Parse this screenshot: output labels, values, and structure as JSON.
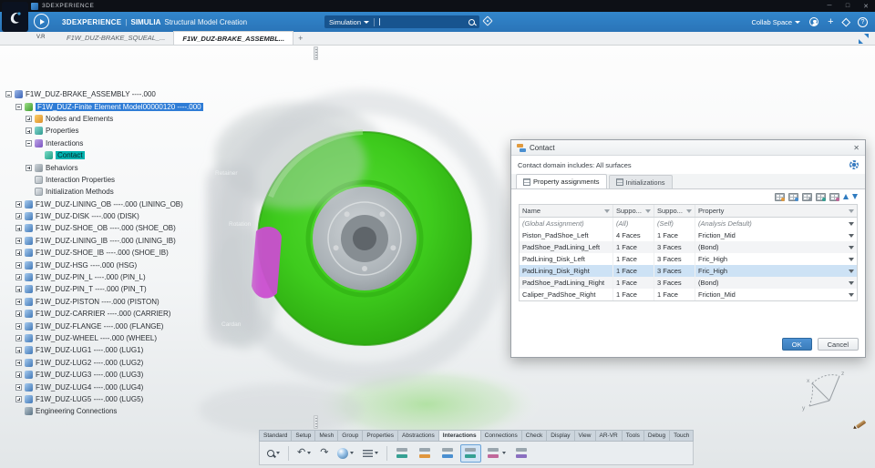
{
  "window": {
    "title": "3DEXPERIENCE",
    "minimize": "─",
    "maximize": "□",
    "close": "✕"
  },
  "appbar": {
    "brand": "3DEXPERIENCE",
    "divider": "|",
    "app_name": "SIMULIA",
    "app_desc": "Structural Model Creation",
    "search_scope": "Simulation",
    "collab_label": "Collab Space",
    "add_label": "+",
    "help_label": "?",
    "icons": [
      "compass-logo-icon",
      "play-compass-icon",
      "search-icon",
      "tag-icon",
      "user-icon",
      "add-icon",
      "share-icon",
      "help-icon"
    ]
  },
  "compass_version": "V.R",
  "doc_tabs": {
    "items": [
      {
        "label": "F1W_DUZ-BRAKE_SQUEAL_...",
        "cls": ""
      },
      {
        "label": "F1W_DUZ-BRAKE_ASSEMBL...",
        "cls": "active"
      }
    ],
    "add_label": "+"
  },
  "tree": {
    "items": [
      {
        "label": "F1W_DUZ-BRAKE_ASSEMBLY ----.000",
        "cls": "lv0",
        "exp": "minus",
        "icon": "i-assembly"
      },
      {
        "label": "F1W_DUZ-Finite Element Model00000120 ----.000",
        "cls": "lv1 sel-blue",
        "exp": "minus",
        "icon": "i-fem"
      },
      {
        "label": "Nodes and Elements",
        "cls": "lv2",
        "exp": "plus",
        "icon": "i-nodes"
      },
      {
        "label": "Properties",
        "cls": "lv2",
        "exp": "plus",
        "icon": "i-props"
      },
      {
        "label": "Interactions",
        "cls": "lv2",
        "exp": "minus",
        "icon": "i-inter"
      },
      {
        "label": "Contact",
        "cls": "lv3 sel-teal",
        "exp": "none",
        "icon": "i-contact"
      },
      {
        "label": "Behaviors",
        "cls": "lv2",
        "exp": "plus",
        "icon": "i-behav"
      },
      {
        "label": "Interaction Properties",
        "cls": "lv2",
        "exp": "none",
        "icon": "i-fold"
      },
      {
        "label": "Initialization Methods",
        "cls": "lv2",
        "exp": "none",
        "icon": "i-fold"
      },
      {
        "label": "F1W_DUZ-LINING_OB ----.000 (LINING_OB)",
        "cls": "lv1",
        "exp": "plus",
        "icon": "i-part"
      },
      {
        "label": "F1W_DUZ-DISK ----.000 (DISK)",
        "cls": "lv1",
        "exp": "plus",
        "icon": "i-part"
      },
      {
        "label": "F1W_DUZ-SHOE_OB ----.000 (SHOE_OB)",
        "cls": "lv1",
        "exp": "plus",
        "icon": "i-part"
      },
      {
        "label": "F1W_DUZ-LINING_IB ----.000 (LINING_IB)",
        "cls": "lv1",
        "exp": "plus",
        "icon": "i-part"
      },
      {
        "label": "F1W_DUZ-SHOE_IB ----.000 (SHOE_IB)",
        "cls": "lv1",
        "exp": "plus",
        "icon": "i-part"
      },
      {
        "label": "F1W_DUZ-HSG ----.000 (HSG)",
        "cls": "lv1",
        "exp": "plus",
        "icon": "i-part"
      },
      {
        "label": "F1W_DUZ-PIN_L ----.000 (PIN_L)",
        "cls": "lv1",
        "exp": "plus",
        "icon": "i-part"
      },
      {
        "label": "F1W_DUZ-PIN_T ----.000 (PIN_T)",
        "cls": "lv1",
        "exp": "plus",
        "icon": "i-part"
      },
      {
        "label": "F1W_DUZ-PISTON ----.000 (PISTON)",
        "cls": "lv1",
        "exp": "plus",
        "icon": "i-part"
      },
      {
        "label": "F1W_DUZ-CARRIER ----.000 (CARRIER)",
        "cls": "lv1",
        "exp": "plus",
        "icon": "i-part"
      },
      {
        "label": "F1W_DUZ-FLANGE ----.000 (FLANGE)",
        "cls": "lv1",
        "exp": "plus",
        "icon": "i-part"
      },
      {
        "label": "F1W_DUZ-WHEEL ----.000 (WHEEL)",
        "cls": "lv1",
        "exp": "plus",
        "icon": "i-part"
      },
      {
        "label": "F1W_DUZ-LUG1 ----.000 (LUG1)",
        "cls": "lv1",
        "exp": "plus",
        "icon": "i-part"
      },
      {
        "label": "F1W_DUZ-LUG2 ----.000 (LUG2)",
        "cls": "lv1",
        "exp": "plus",
        "icon": "i-part"
      },
      {
        "label": "F1W_DUZ-LUG3 ----.000 (LUG3)",
        "cls": "lv1",
        "exp": "plus",
        "icon": "i-part"
      },
      {
        "label": "F1W_DUZ-LUG4 ----.000 (LUG4)",
        "cls": "lv1",
        "exp": "plus",
        "icon": "i-part"
      },
      {
        "label": "F1W_DUZ-LUG5 ----.000 (LUG5)",
        "cls": "lv1",
        "exp": "plus",
        "icon": "i-part"
      },
      {
        "label": "Engineering Connections",
        "cls": "lv1",
        "exp": "none",
        "icon": "i-engc"
      }
    ]
  },
  "viewport": {
    "labels": [
      "Retainer",
      "Rotation",
      "Cardan"
    ],
    "compass": {
      "x": "x",
      "y": "y",
      "z": "z"
    }
  },
  "dialog": {
    "title": "Contact",
    "close": "✕",
    "domain_text": "Contact domain includes: All surfaces",
    "tabs": [
      {
        "label": "Property assignments",
        "cls": "active"
      },
      {
        "label": "Initializations",
        "cls": ""
      }
    ],
    "columns": [
      "Name",
      "Suppo...",
      "Suppo...",
      "Property"
    ],
    "rows": [
      {
        "name": "(Global Assignment)",
        "s1": "(All)",
        "s2": "(Self)",
        "prop": "(Analysis Default)",
        "cls": "global"
      },
      {
        "name": "Piston_PadShoe_Left",
        "s1": "4 Faces",
        "s2": "1 Face",
        "prop": "Friction_Mid",
        "cls": ""
      },
      {
        "name": "PadShoe_PadLining_Left",
        "s1": "1 Face",
        "s2": "3 Faces",
        "prop": "(Bond)",
        "cls": "alt"
      },
      {
        "name": "PadLining_Disk_Left",
        "s1": "1 Face",
        "s2": "3 Faces",
        "prop": "Fric_High",
        "cls": ""
      },
      {
        "name": "PadLining_Disk_Right",
        "s1": "1 Face",
        "s2": "3 Faces",
        "prop": "Fric_High",
        "cls": "selected"
      },
      {
        "name": "PadShoe_PadLining_Right",
        "s1": "1 Face",
        "s2": "3 Faces",
        "prop": "(Bond)",
        "cls": "alt"
      },
      {
        "name": "Caliper_PadShoe_Right",
        "s1": "1 Face",
        "s2": "1 Face",
        "prop": "Friction_Mid",
        "cls": ""
      }
    ],
    "ok_label": "OK",
    "cancel_label": "Cancel",
    "toolbar_icons": [
      "add-row-icon",
      "edit-table-icon",
      "filter-table-icon",
      "columns-icon",
      "export-table-icon",
      "move-up-icon",
      "move-down-icon"
    ]
  },
  "ribbon": {
    "tabs": [
      {
        "label": "Standard",
        "cls": ""
      },
      {
        "label": "Setup",
        "cls": ""
      },
      {
        "label": "Mesh",
        "cls": ""
      },
      {
        "label": "Group",
        "cls": ""
      },
      {
        "label": "Properties",
        "cls": ""
      },
      {
        "label": "Abstractions",
        "cls": ""
      },
      {
        "label": "Interactions",
        "cls": "active"
      },
      {
        "label": "Connections",
        "cls": ""
      },
      {
        "label": "Check",
        "cls": ""
      },
      {
        "label": "Display",
        "cls": ""
      },
      {
        "label": "View",
        "cls": ""
      },
      {
        "label": "AR-VR",
        "cls": ""
      },
      {
        "label": "Tools",
        "cls": ""
      },
      {
        "label": "Debug",
        "cls": ""
      },
      {
        "label": "Touch",
        "cls": ""
      }
    ],
    "glyphs": {
      "undo": "↶",
      "redo": "↷"
    },
    "icons": [
      "search-tool-icon",
      "undo-icon",
      "redo-icon",
      "sphere-icon",
      "list-icon",
      "detect-contacts-icon",
      "general-contact-icon",
      "contact-pair-icon",
      "contact-icon",
      "tie-icon",
      "initialization-icon"
    ]
  },
  "colors": {
    "accent_blue": "#2d7dc4",
    "selection_blue": "#2e7cd6",
    "selection_teal": "#00b0ae",
    "disk_green": "#3fd01d",
    "pad_magenta": "#ca4ed0"
  }
}
